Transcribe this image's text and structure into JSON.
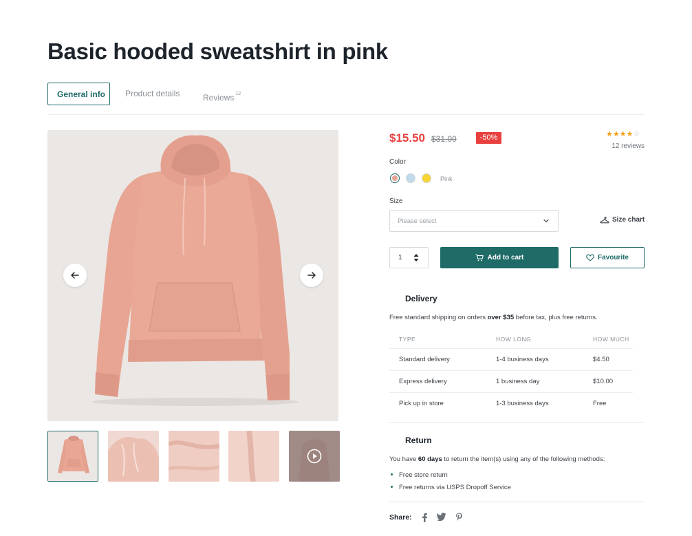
{
  "product": {
    "title": "Basic hooded sweatshirt in pink",
    "price": "$15.50",
    "old_price": "$31.00",
    "discount": "-50%",
    "rating": 4,
    "rating_max": 5,
    "reviews_label": "12 reviews"
  },
  "tabs": [
    {
      "label": "General info",
      "active": true
    },
    {
      "label": "Product details",
      "active": false
    },
    {
      "label": "Reviews",
      "badge": "12",
      "active": false
    }
  ],
  "color": {
    "label": "Color",
    "selected": "Pink",
    "swatches": [
      "#e8a192",
      "#bfdaea",
      "#f7d634"
    ]
  },
  "size": {
    "label": "Size",
    "placeholder": "Please select",
    "chart_label": "Size chart"
  },
  "quantity": "1",
  "buttons": {
    "add_to_cart": "Add to cart",
    "favourite": "Favourite"
  },
  "delivery": {
    "title": "Delivery",
    "intro_before": "Free standard shipping on orders ",
    "intro_bold": "over $35",
    "intro_after": " before tax, plus free returns.",
    "headers": [
      "TYPE",
      "HOW LONG",
      "HOW MUCH"
    ],
    "rows": [
      [
        "Standard delivery",
        "1-4 business days",
        "$4.50"
      ],
      [
        "Express delivery",
        "1 business day",
        "$10.00"
      ],
      [
        "Pick up in store",
        "1-3 business days",
        "Free"
      ]
    ]
  },
  "return": {
    "title": "Return",
    "intro_before": "You have ",
    "intro_bold": "60 days",
    "intro_after": " to return the item(s) using any of the following methods:",
    "methods": [
      "Free store return",
      "Free returns via USPS Dropoff Service"
    ]
  },
  "share": {
    "label": "Share:",
    "icons": [
      "facebook-icon",
      "twitter-icon",
      "pinterest-icon"
    ]
  },
  "gallery": {
    "thumbnail_count": 5,
    "active_index": 0
  },
  "colors": {
    "accent": "#1e6b68",
    "sale": "#e8403f",
    "star": "#f39c12"
  }
}
